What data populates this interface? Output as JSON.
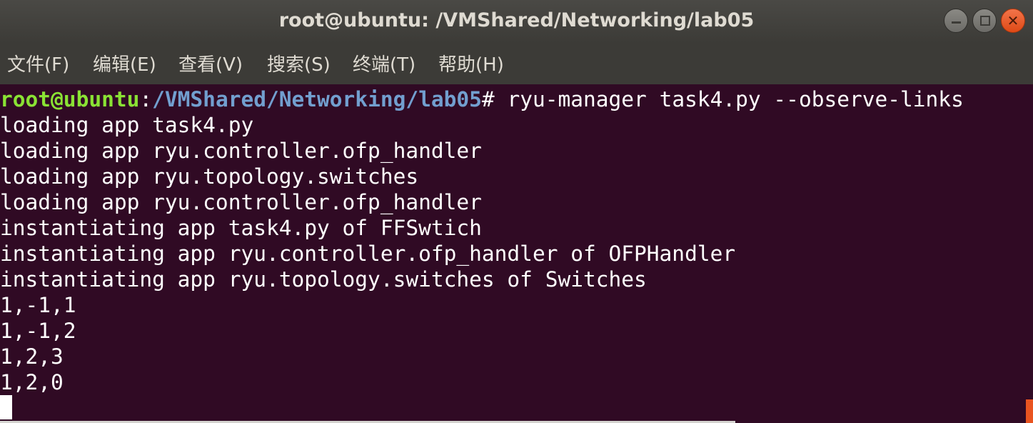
{
  "window": {
    "title": "root@ubuntu: /VMShared/Networking/lab05",
    "buttons": {
      "minimize": "minimize",
      "maximize": "maximize",
      "close": "close"
    }
  },
  "menu": [
    {
      "label": "文件(F)"
    },
    {
      "label": "编辑(E)"
    },
    {
      "label": "查看(V)"
    },
    {
      "label": "搜索(S)"
    },
    {
      "label": "终端(T)"
    },
    {
      "label": "帮助(H)"
    }
  ],
  "terminal": {
    "prompt": {
      "user_host": "root@ubuntu",
      "colon": ":",
      "path": "/VMShared/Networking/lab05",
      "symbol": "#",
      "command": " ryu-manager task4.py --observe-links"
    },
    "output": [
      "loading app task4.py",
      "loading app ryu.controller.ofp_handler",
      "loading app ryu.topology.switches",
      "loading app ryu.controller.ofp_handler",
      "instantiating app task4.py of FFSwtich",
      "instantiating app ryu.controller.ofp_handler of OFPHandler",
      "instantiating app ryu.topology.switches of Switches",
      "1,-1,1",
      "1,-1,2",
      "1,2,3",
      "1,2,0"
    ]
  },
  "colors": {
    "terminal_bg": "#300a24",
    "prompt_user": "#8ae234",
    "prompt_path": "#729fcf",
    "titlebar": "#3c3b37",
    "close_button": "#e95420"
  }
}
